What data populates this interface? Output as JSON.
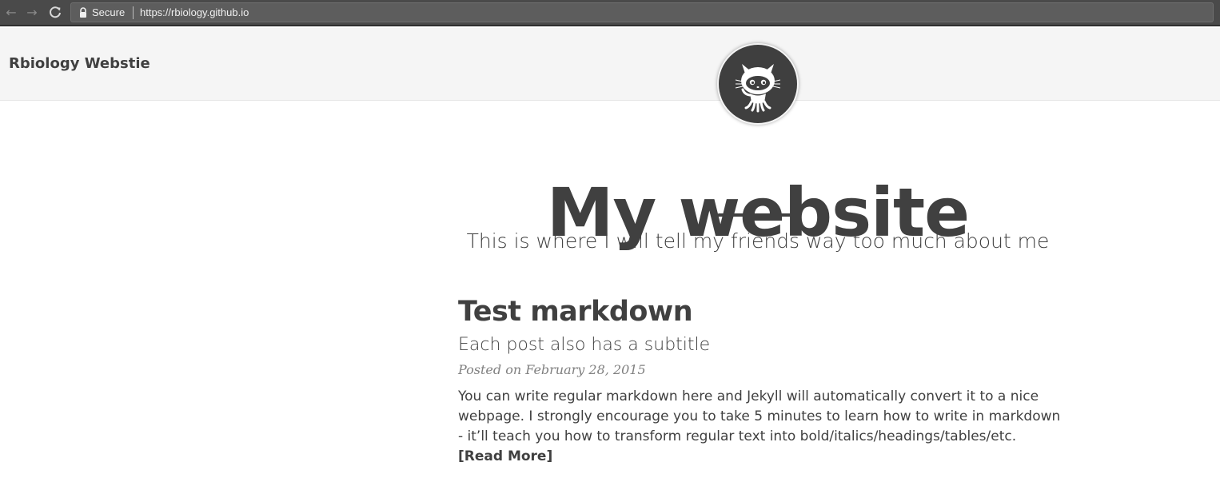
{
  "browser": {
    "back_icon": "arrow-left-icon",
    "forward_icon": "arrow-right-icon",
    "reload_icon": "reload-icon",
    "lock_icon": "lock-icon",
    "secure_label": "Secure",
    "url": "https://rbiology.github.io"
  },
  "navbar": {
    "brand": "Rbiology Webstie",
    "avatar_icon": "github-octocat-icon"
  },
  "header": {
    "title": "My website",
    "subtitle": "This is where I will tell my friends way too much about me"
  },
  "posts": [
    {
      "title": "Test markdown",
      "subtitle": "Each post also has a subtitle",
      "meta": "Posted on February 28, 2015",
      "excerpt": "You can write regular markdown here and Jekyll will automatically convert it to a nice webpage. I strongly encourage you to take 5 minutes to learn how to write in markdown - it’ll teach you how to transform regular text into bold/italics/headings/tables/etc.",
      "read_more": "[Read More]"
    }
  ],
  "colors": {
    "text": "#404040",
    "navbar_bg": "#f5f5f5",
    "chrome_bg": "#4a4a4a",
    "meta": "#808080"
  }
}
